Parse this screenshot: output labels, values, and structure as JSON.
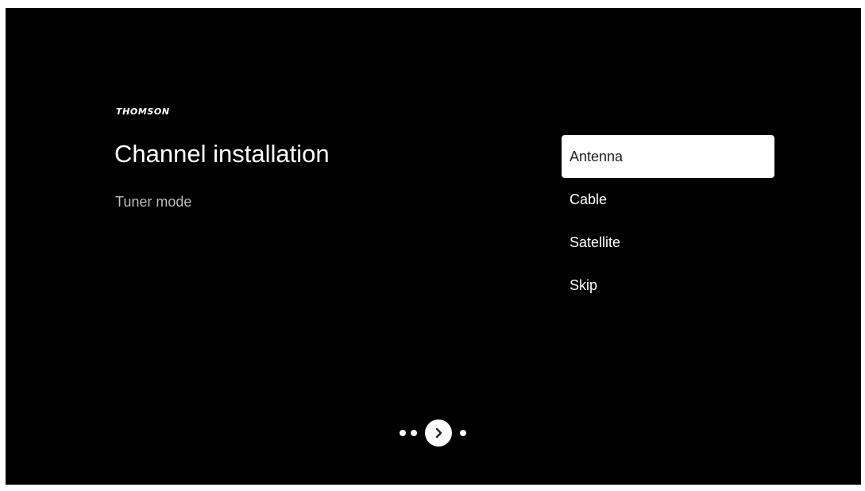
{
  "brand": {
    "logo_text": "THOMSON"
  },
  "header": {
    "title": "Channel installation",
    "subtitle": "Tuner mode"
  },
  "tuner_options": {
    "selected": "Antenna",
    "items": [
      {
        "label": "Antenna"
      },
      {
        "label": "Cable"
      },
      {
        "label": "Satellite"
      },
      {
        "label": "Skip"
      }
    ]
  },
  "pager": {
    "current_step": 3,
    "total_steps": 4,
    "icon": "chevron-right-icon"
  },
  "colors": {
    "background": "#000000",
    "text": "#ffffff",
    "subtitle": "#bdbdbd",
    "focus_background": "#ffffff",
    "focus_text": "#202124"
  }
}
